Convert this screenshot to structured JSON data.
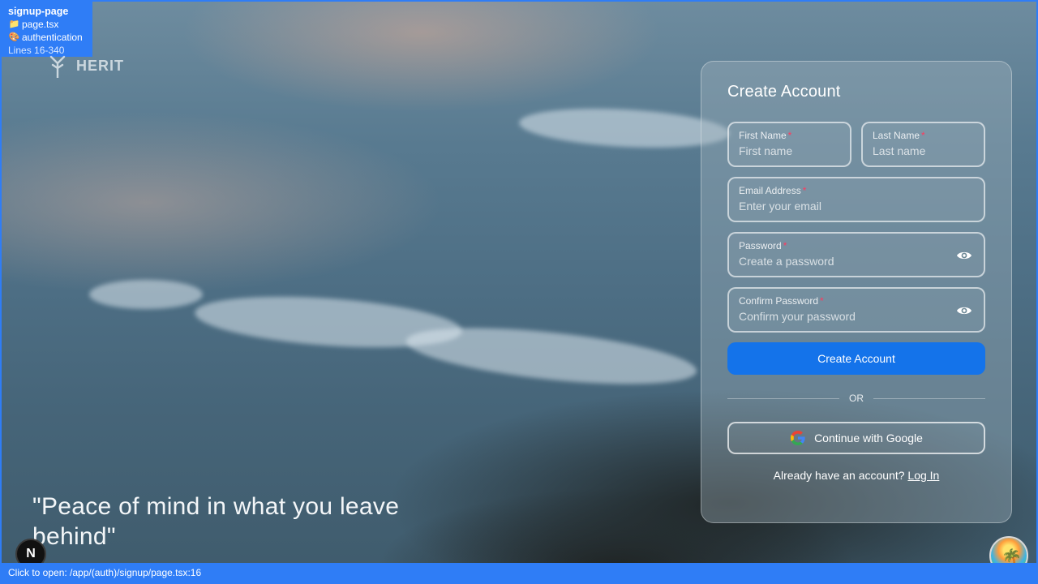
{
  "dev_overlay": {
    "component": "signup-page",
    "file": "page.tsx",
    "section": "authentication",
    "lines": "Lines 16-340"
  },
  "brand": {
    "logo_text": "HERIT"
  },
  "hero": {
    "quote": "\"Peace of mind in what you leave behind\""
  },
  "next_badge": {
    "letter": "N"
  },
  "status_bar": {
    "text": "Click to open: /app/(auth)/signup/page.tsx:16"
  },
  "form": {
    "title": "Create Account",
    "first_name": {
      "label": "First Name",
      "required": "*",
      "placeholder": "First name"
    },
    "last_name": {
      "label": "Last Name",
      "required": "*",
      "placeholder": "Last name"
    },
    "email": {
      "label": "Email Address",
      "required": "*",
      "placeholder": "Enter your email"
    },
    "password": {
      "label": "Password",
      "required": "*",
      "placeholder": "Create a password"
    },
    "confirm_password": {
      "label": "Confirm Password",
      "required": "*",
      "placeholder": "Confirm your password"
    },
    "submit_label": "Create Account",
    "divider_text": "OR",
    "google_label": "Continue with Google",
    "login_prompt": "Already have an account?",
    "login_link": "Log In"
  },
  "colors": {
    "accent": "#1473ea",
    "required": "#ff3a5e",
    "dev_overlay": "#2f7df6"
  },
  "icons": [
    "logo-icon",
    "folder-icon",
    "palette-icon",
    "eye-icon",
    "google-icon",
    "avatar-icon"
  ]
}
